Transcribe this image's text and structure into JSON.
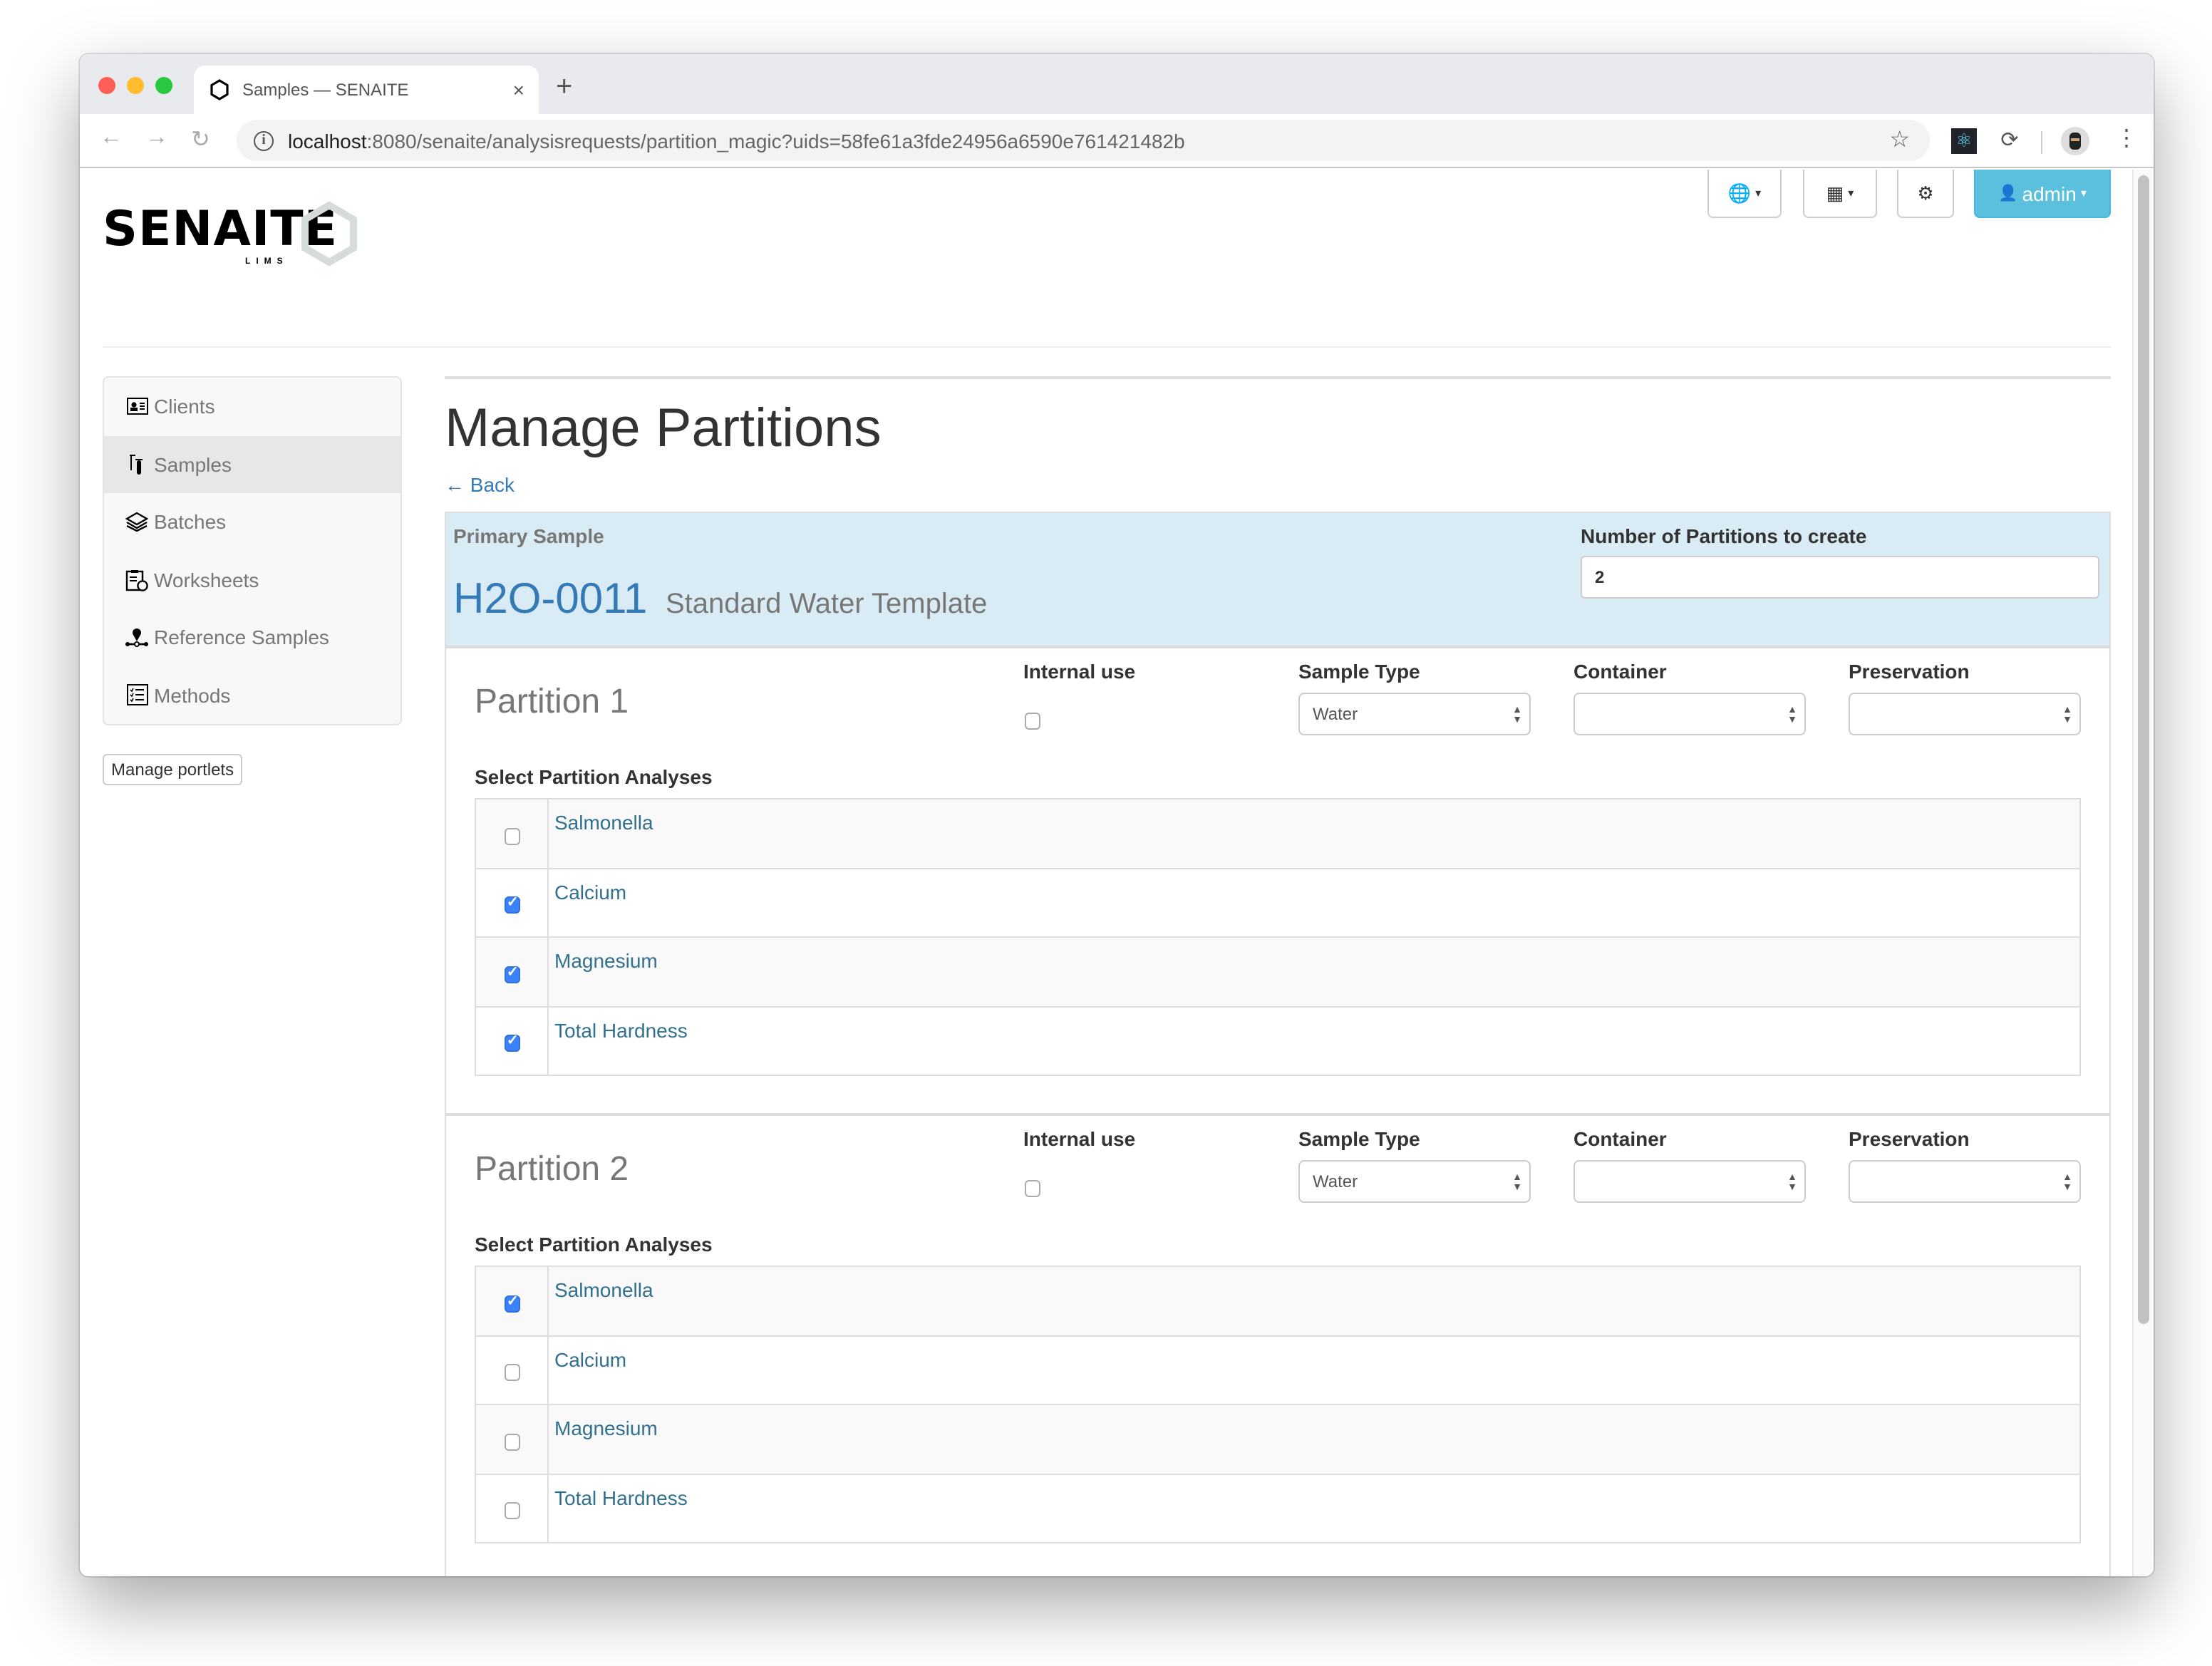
{
  "browser": {
    "tab_title": "Samples — SENAITE",
    "url_host": "localhost",
    "url_rest": ":8080/senaite/analysisrequests/partition_magic?uids=58fe61a3fde24956a6590e761421482b",
    "icons": {
      "back": "←",
      "forward": "→",
      "reload": "↻",
      "star": "☆",
      "react_ext": "⚛",
      "sync_ext": "⟳",
      "menu": "⋮",
      "new_tab": "+",
      "tab_close": "×"
    }
  },
  "header": {
    "logo_text": "SENAITE",
    "logo_sub": "LIMS",
    "buttons": {
      "language_icon": "🌐",
      "apps_icon": "▦",
      "settings_icon": "⚙",
      "user_icon": "👤",
      "user_label": "admin",
      "caret": "▾"
    }
  },
  "sidebar": {
    "items": [
      {
        "label": "Clients",
        "icon": "▣",
        "active": false
      },
      {
        "label": "Samples",
        "icon": "⚗",
        "active": true
      },
      {
        "label": "Batches",
        "icon": "≋",
        "active": false
      },
      {
        "label": "Worksheets",
        "icon": "☑",
        "active": false
      },
      {
        "label": "Reference Samples",
        "icon": "⚲",
        "active": false
      },
      {
        "label": "Methods",
        "icon": "☰",
        "active": false
      }
    ],
    "manage_portlets": "Manage portlets"
  },
  "main": {
    "title": "Manage Partitions",
    "back_link": "← Back",
    "primary_sample": {
      "label": "Primary Sample",
      "id": "H2O-0011",
      "template": "Standard Water Template"
    },
    "num_partitions": {
      "label": "Number of Partitions to create",
      "value": "2"
    },
    "field_labels": {
      "internal_use": "Internal use",
      "sample_type": "Sample Type",
      "container": "Container",
      "preservation": "Preservation",
      "select_analyses": "Select Partition Analyses"
    },
    "partitions": [
      {
        "title": "Partition 1",
        "internal_use": false,
        "sample_type": "Water",
        "container": "",
        "preservation": "",
        "analyses": [
          {
            "name": "Salmonella",
            "checked": false
          },
          {
            "name": "Calcium",
            "checked": true
          },
          {
            "name": "Magnesium",
            "checked": true
          },
          {
            "name": "Total Hardness",
            "checked": true
          }
        ]
      },
      {
        "title": "Partition 2",
        "internal_use": false,
        "sample_type": "Water",
        "container": "",
        "preservation": "",
        "analyses": [
          {
            "name": "Salmonella",
            "checked": true
          },
          {
            "name": "Calcium",
            "checked": false
          },
          {
            "name": "Magnesium",
            "checked": false
          },
          {
            "name": "Total Hardness",
            "checked": false
          }
        ]
      }
    ]
  },
  "colors": {
    "primary_box_bg": "#d9ebf5",
    "link": "#337ab7",
    "analysis_link": "#31708f",
    "admin_button": "#5bc0de",
    "checkbox_checked": "#3b82f6"
  }
}
